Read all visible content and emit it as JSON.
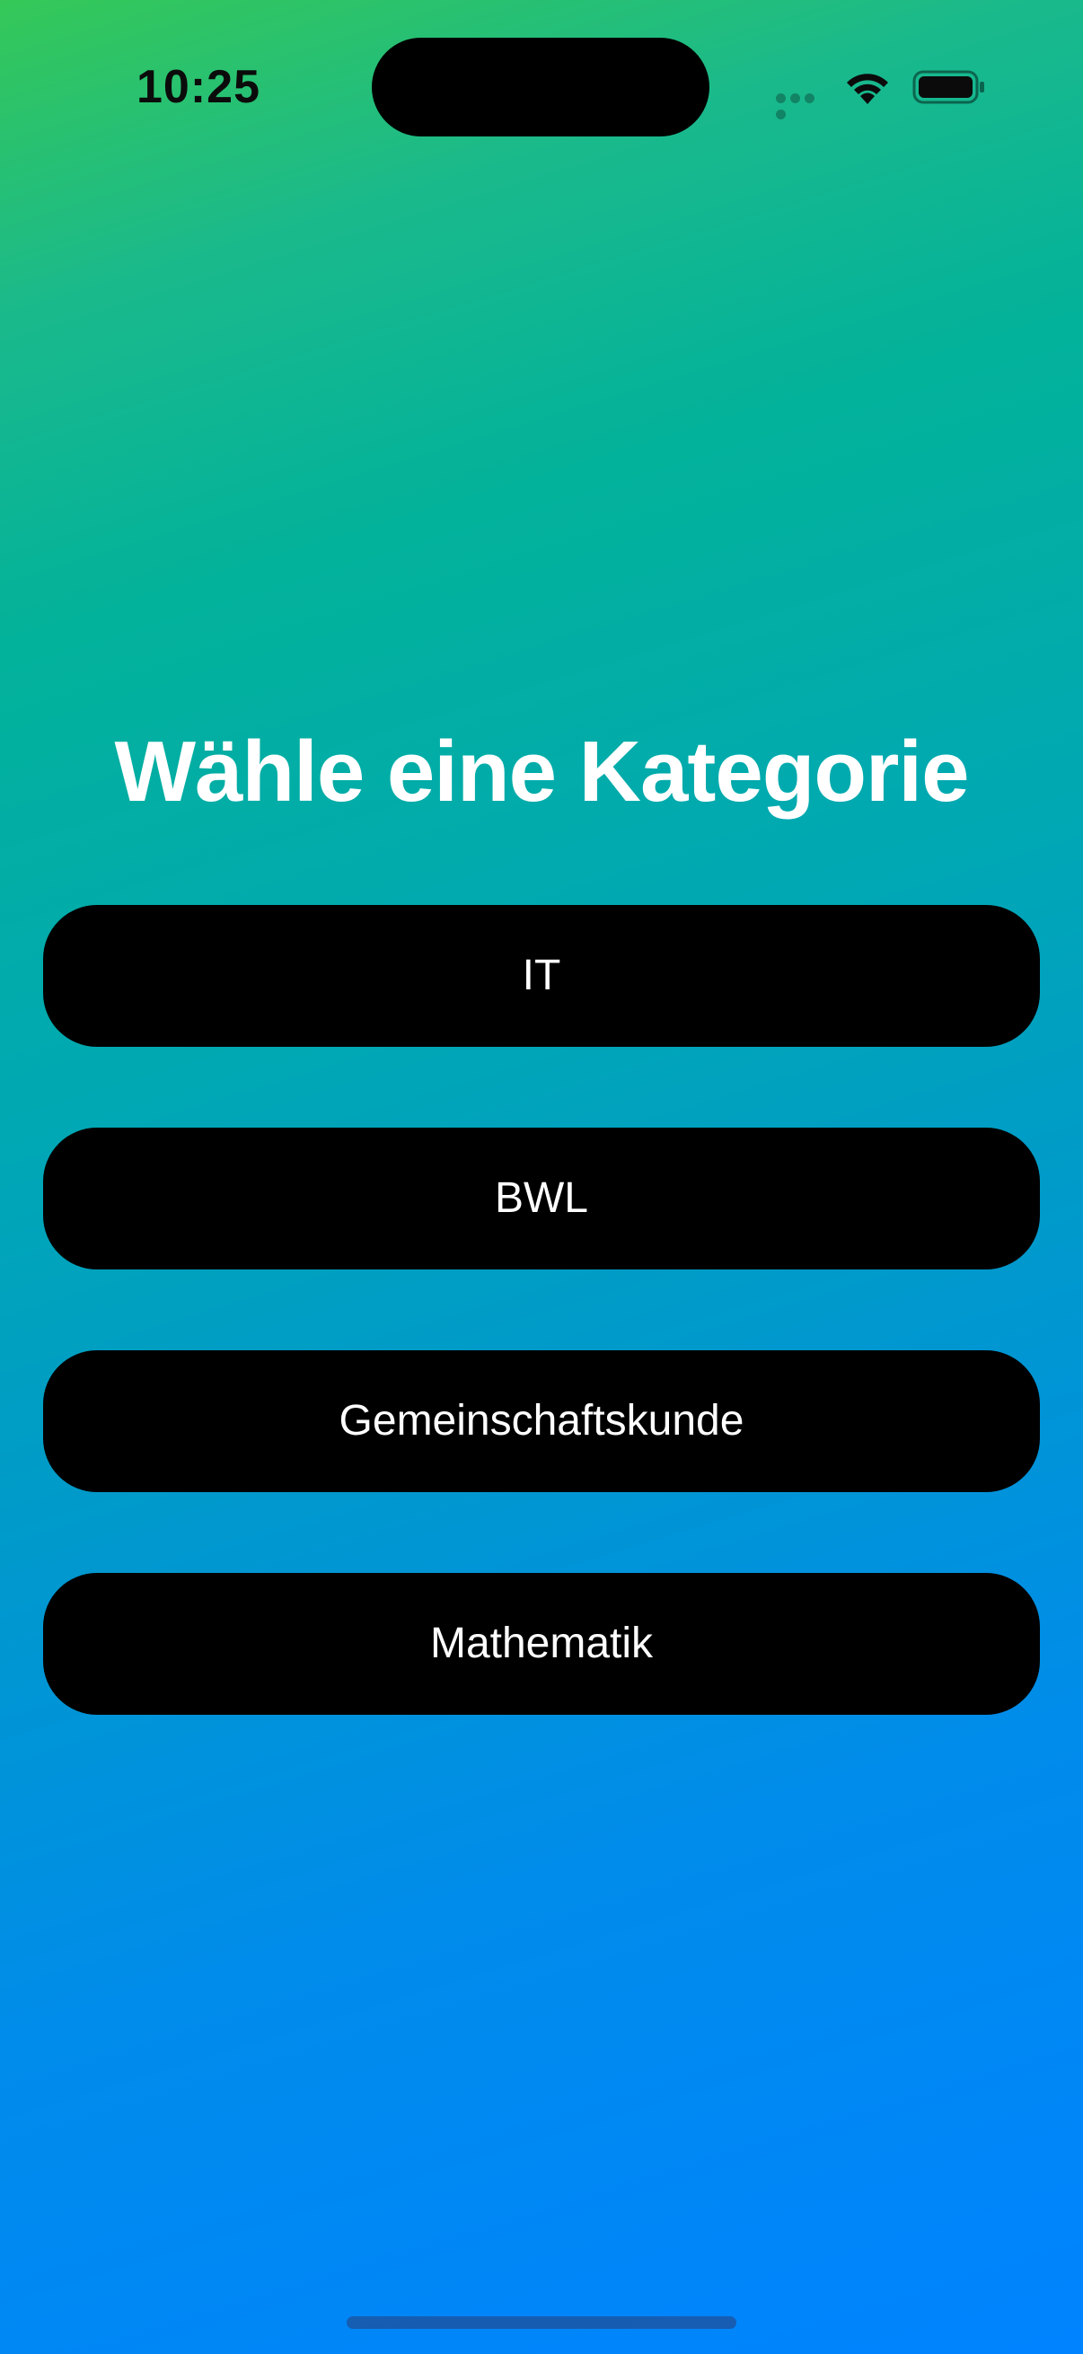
{
  "status_bar": {
    "time": "10:25",
    "icons": [
      "cellular-signal-icon",
      "wifi-icon",
      "battery-icon"
    ]
  },
  "main": {
    "title": "Wähle eine Kategorie",
    "categories": [
      {
        "label": "IT"
      },
      {
        "label": "BWL"
      },
      {
        "label": "Gemeinschaftskunde"
      },
      {
        "label": "Mathematik"
      }
    ]
  },
  "colors": {
    "gradient_top": "#35c858",
    "gradient_middle": "#00a8b3",
    "gradient_bottom": "#0083ff",
    "button_background": "#000000",
    "button_text": "#ffffff",
    "title_text": "#ffffff"
  }
}
